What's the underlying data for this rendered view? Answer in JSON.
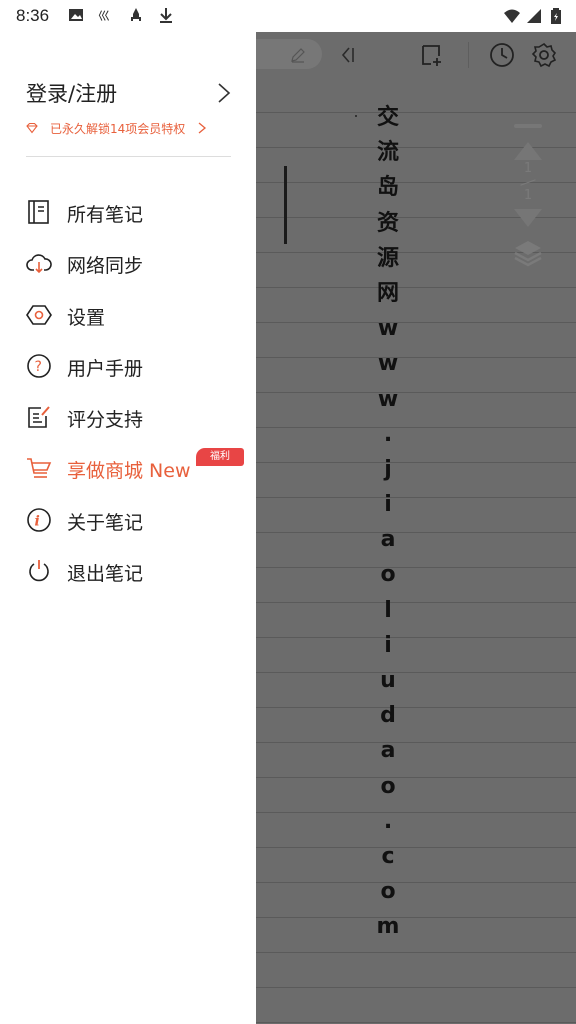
{
  "status_bar": {
    "time": "8:36",
    "left_icons": [
      "image-icon",
      "app-notification-icon",
      "rocket-icon",
      "download-icon"
    ],
    "right_icons": [
      "wifi-icon",
      "signal-icon",
      "battery-icon"
    ]
  },
  "drawer": {
    "login_label": "登录/注册",
    "vip_text": "已永久解锁14项会员特权",
    "accent_color": "#e8603c",
    "menu": [
      {
        "label": "所有笔记",
        "icon": "notebook-icon"
      },
      {
        "label": "网络同步",
        "icon": "cloud-sync-icon"
      },
      {
        "label": "设置",
        "icon": "settings-hexagon-icon"
      },
      {
        "label": "用户手册",
        "icon": "help-icon"
      },
      {
        "label": "评分支持",
        "icon": "rate-edit-icon"
      },
      {
        "label": "享做商城 New",
        "icon": "cart-icon",
        "badge": "福利"
      },
      {
        "label": "关于笔记",
        "icon": "info-icon"
      },
      {
        "label": "退出笔记",
        "icon": "power-icon"
      }
    ]
  },
  "note": {
    "vertical_text": [
      "交",
      "流",
      "岛",
      "资",
      "源",
      "网",
      "w",
      "w",
      "w",
      ".",
      "j",
      "i",
      "a",
      "o",
      "l",
      "i",
      "u",
      "d",
      "a",
      "o",
      ".",
      "c",
      "o",
      "m"
    ],
    "pager": {
      "current": "1",
      "total": "1"
    }
  }
}
